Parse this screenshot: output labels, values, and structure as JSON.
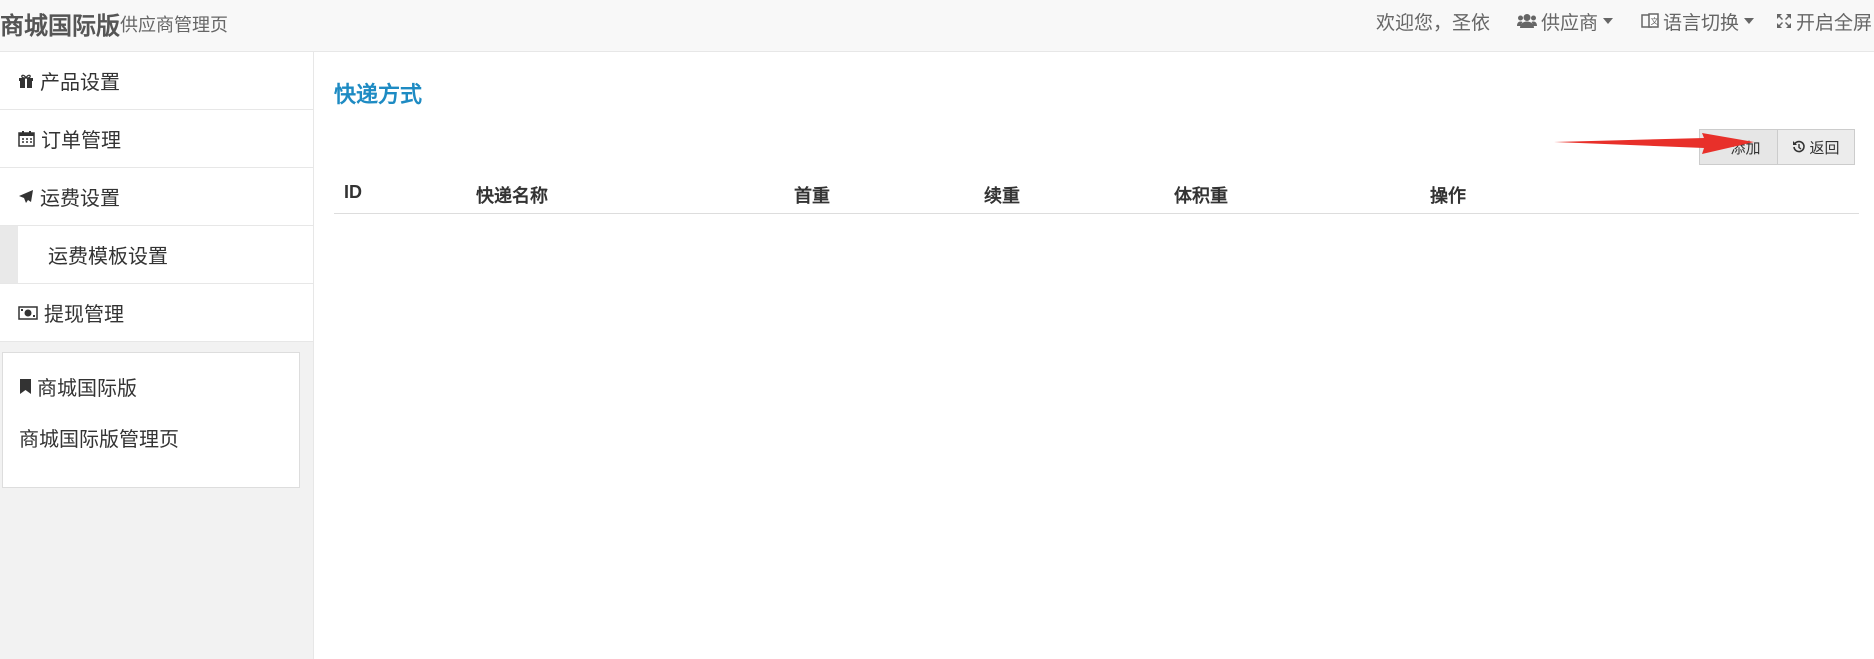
{
  "header": {
    "brand": "商城国际版",
    "brand_sub": "供应商管理页",
    "welcome": "欢迎您，圣依",
    "user_menu": "供应商",
    "language_menu": "语言切换",
    "fullscreen": "开启全屏"
  },
  "sidebar": {
    "items": [
      {
        "label": "产品设置",
        "icon": "gift-icon"
      },
      {
        "label": "订单管理",
        "icon": "calendar-icon"
      },
      {
        "label": "运费设置",
        "icon": "plane-icon"
      },
      {
        "label": "运费模板设置",
        "icon": ""
      },
      {
        "label": "提现管理",
        "icon": "money-icon"
      }
    ],
    "info_box": {
      "title": "商城国际版",
      "description": "商城国际版管理页",
      "icon": "bookmark-icon"
    }
  },
  "main": {
    "title": "快递方式",
    "add_label": "添加",
    "back_label": "返回",
    "columns": [
      "ID",
      "快递名称",
      "首重",
      "续重",
      "体积重",
      "操作"
    ],
    "rows": []
  },
  "colors": {
    "title": "#1e8bc3",
    "arrow": "#e8302a"
  }
}
